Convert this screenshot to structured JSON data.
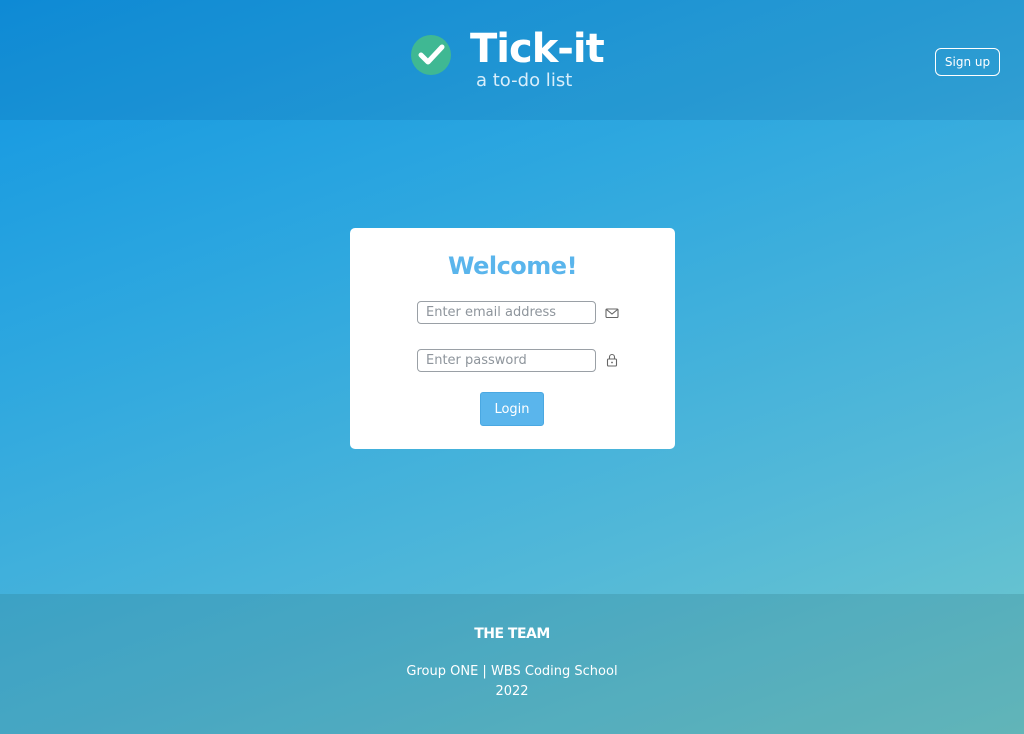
{
  "header": {
    "logo_title": "Tick-it",
    "logo_subtitle": "a to-do list",
    "logo_icon": "check-circle-icon",
    "signup_label": "Sign up"
  },
  "login_card": {
    "heading": "Welcome!",
    "email": {
      "value": "",
      "placeholder": "Enter email address",
      "icon": "mail-icon"
    },
    "password": {
      "value": "",
      "placeholder": "Enter password",
      "icon": "lock-icon"
    },
    "login_label": "Login"
  },
  "footer": {
    "title": "THE TEAM",
    "line1": "Group ONE | WBS Coding School",
    "line2": "2022"
  },
  "colors": {
    "accent": "#5ab5ec",
    "logo_check_bg": "#3fb893",
    "background_start": "#1196e2",
    "background_end": "#72c9cb"
  }
}
